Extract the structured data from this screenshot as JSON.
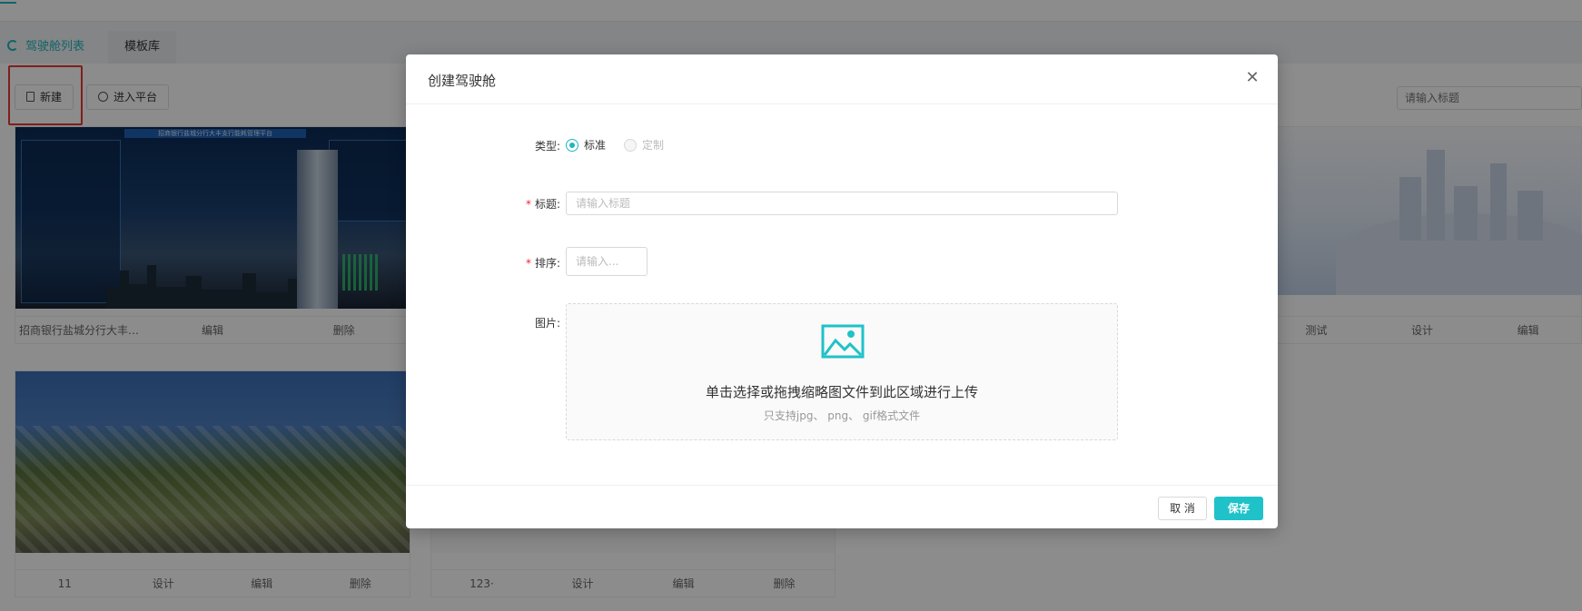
{
  "tabs": [
    {
      "label": "驾驶舱列表",
      "active": true
    },
    {
      "label": "模板库",
      "active": false
    }
  ],
  "toolbar": {
    "new_label": "新建",
    "enter_label": "进入平台",
    "search_placeholder": "请输入标题"
  },
  "cards": [
    {
      "title": "招商银行盐城分行大丰支...",
      "actions": [
        "编辑",
        "删除"
      ]
    },
    {
      "title": "测试",
      "actions": [
        "设计",
        "编辑"
      ]
    },
    {
      "title": "11",
      "actions": [
        "设计",
        "编辑",
        "删除"
      ]
    },
    {
      "title": "123·",
      "actions": [
        "设计",
        "编辑",
        "删除"
      ]
    }
  ],
  "dashboard_banner": "招商银行盐城分行大丰支行能耗管理平台",
  "modal": {
    "title": "创建驾驶舱",
    "type_label": "类型:",
    "type_options": [
      {
        "label": "标准",
        "checked": true,
        "disabled": false
      },
      {
        "label": "定制",
        "checked": false,
        "disabled": true
      }
    ],
    "title_label": "标题:",
    "title_placeholder": "请输入标题",
    "order_label": "排序:",
    "order_placeholder": "请输入...",
    "image_label": "图片:",
    "upload_main": "单击选择或拖拽缩略图文件到此区域进行上传",
    "upload_hint": "只支持jpg、 png、 gif格式文件",
    "cancel_label": "取 消",
    "save_label": "保存"
  },
  "colors": {
    "accent": "#1fc2c8",
    "required": "#f5222d",
    "highlight": "#e53935"
  }
}
